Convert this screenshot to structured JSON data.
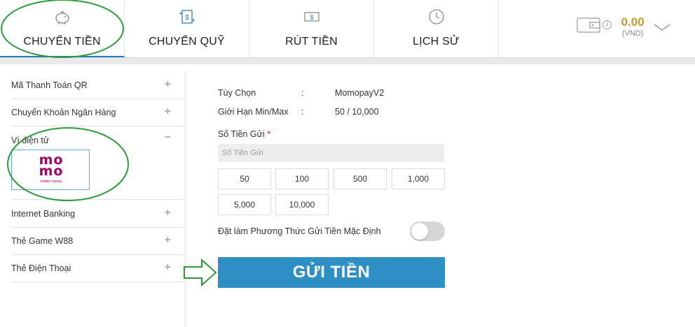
{
  "nav": {
    "tabs": [
      {
        "label": "CHUYỂN TIỀN",
        "icon": "piggy-bank-icon"
      },
      {
        "label": "CHUYỂN QUỸ",
        "icon": "transfer-icon"
      },
      {
        "label": "RÚT TIỀN",
        "icon": "withdraw-icon"
      },
      {
        "label": "LỊCH SỬ",
        "icon": "history-icon"
      }
    ],
    "active_tab": 0,
    "balance": "0.00",
    "currency": "(VND)",
    "info_icon": "i"
  },
  "sidebar": {
    "items": [
      {
        "label": "Mã Thanh Toán QR",
        "sign": "+"
      },
      {
        "label": "Chuyển Khoản Ngân Hàng",
        "sign": "+"
      },
      {
        "label": "Ví điện tử",
        "sign": "−"
      },
      {
        "label": "Internet Banking",
        "sign": "+"
      },
      {
        "label": "Thẻ Game W88",
        "sign": "+"
      },
      {
        "label": "Thẻ Điện Thoại",
        "sign": "+"
      }
    ],
    "momo": {
      "line1": "mo",
      "line2": "mo",
      "sub": "mobile money"
    }
  },
  "main": {
    "option_label": "Tùy Chọn",
    "option_sep": ":",
    "option_value": "MomopayV2",
    "limit_label": "Giới Hạn Min/Max",
    "limit_sep": ":",
    "limit_value": "50 / 10,000",
    "amount_label": "Số Tiền Gửi",
    "amount_required": "*",
    "amount_placeholder": "Số Tiền Gửi",
    "quick_amounts": [
      "50",
      "100",
      "500",
      "1,000",
      "5,000",
      "10,000"
    ],
    "default_toggle_label": "Đặt làm Phương Thức Gửi Tiền Mặc Định",
    "default_toggle_on": false,
    "submit_label": "GỬI TIỀN"
  },
  "colors": {
    "accent": "#2e8fc4",
    "balance": "#c89a2a",
    "momo": "#a50064",
    "annotation": "#2e9b3a"
  }
}
